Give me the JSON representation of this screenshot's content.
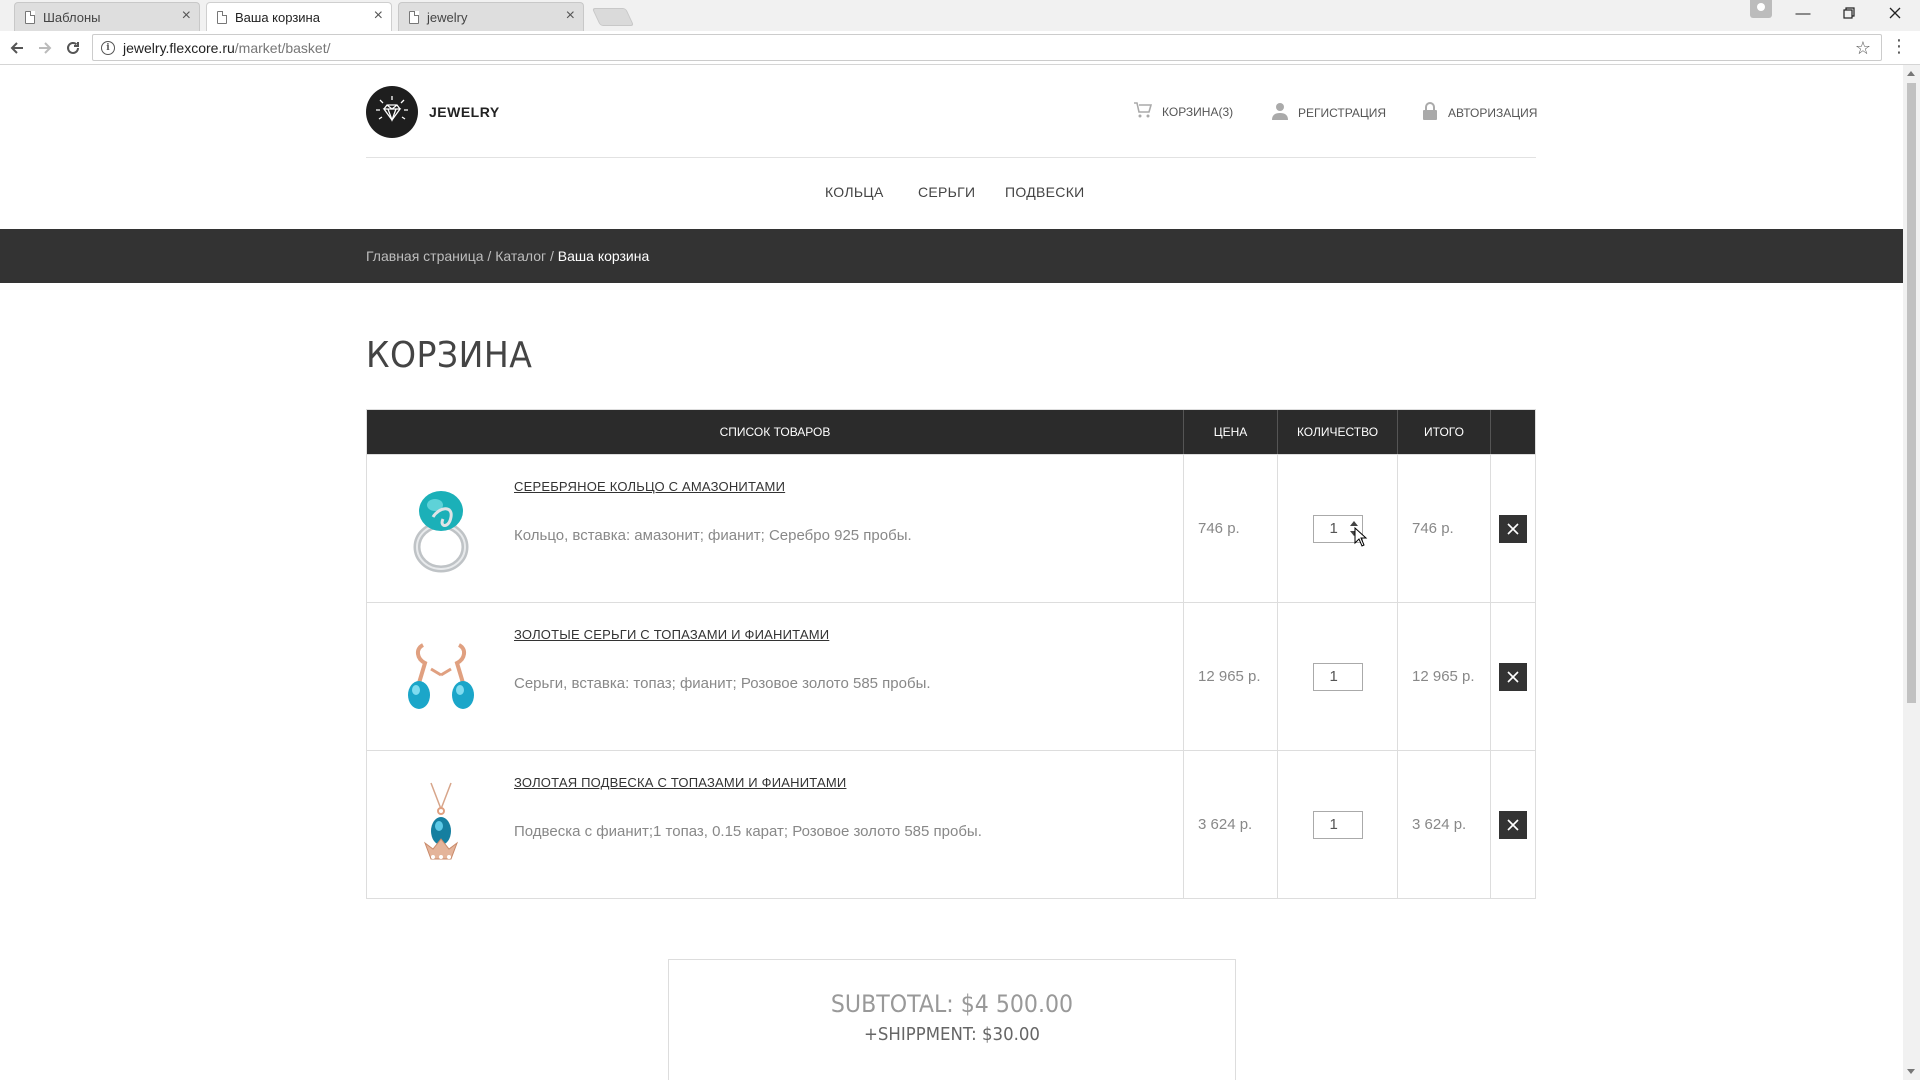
{
  "browser": {
    "tabs": [
      {
        "title": "Шаблоны",
        "active": false
      },
      {
        "title": "Ваша корзина",
        "active": true
      },
      {
        "title": "jewelry",
        "active": false
      }
    ],
    "url_host": "jewelry.flexcore.ru",
    "url_path": "/market/basket/"
  },
  "header": {
    "logo_text": "JEWELRY",
    "cart_label": "КОРЗИНА(3)",
    "register_label": "РЕГИСТРАЦИЯ",
    "login_label": "АВТОРИЗАЦИЯ"
  },
  "catalog_nav": [
    "КОЛЬЦА",
    "СЕРЬГИ",
    "ПОДВЕСКИ"
  ],
  "breadcrumbs": {
    "home": "Главная страница",
    "sep": " / ",
    "catalog": "Каталог",
    "current": "Ваша корзина"
  },
  "page_title": "КОРЗИНА",
  "basket": {
    "headers": {
      "items": "СПИСОК ТОВАРОВ",
      "price": "ЦЕНА",
      "qty": "КОЛИЧЕСТВО",
      "total": "ИТОГО"
    },
    "rows": [
      {
        "name": "СЕРЕБРЯНОЕ КОЛЬЦО С АМАЗОНИТАМИ",
        "desc": "Кольцо, вставка: амазонит; фианит; Серебро 925 пробы.",
        "price": "746 р.",
        "qty": "1",
        "total": "746 р."
      },
      {
        "name": "ЗОЛОТЫЕ СЕРЬГИ С ТОПАЗАМИ И ФИАНИТАМИ",
        "desc": "Серьги, вставка: топаз; фианит; Розовое золото 585 пробы.",
        "price": "12 965 р.",
        "qty": "1",
        "total": "12 965 р."
      },
      {
        "name": "ЗОЛОТАЯ ПОДВЕСКА С ТОПАЗАМИ И ФИАНИТАМИ",
        "desc": "Подвеска с фианит;1 топаз, 0.15 карат; Розовое золото 585 пробы.",
        "price": "3 624 р.",
        "qty": "1",
        "total": "3 624 р."
      }
    ]
  },
  "summary": {
    "subtotal": "SUBTOTAL: $4 500.00",
    "shipment": "+SHIPPMENT: $30.00"
  },
  "colors": {
    "dark_bar": "#333333",
    "table_header": "#2b2b2b",
    "gem_teal": "#1bb0b8",
    "rose_gold": "#e0a080"
  },
  "icons": {
    "cart": "cart-icon",
    "user": "user-icon",
    "lock": "lock-icon",
    "delete": "close-icon"
  }
}
